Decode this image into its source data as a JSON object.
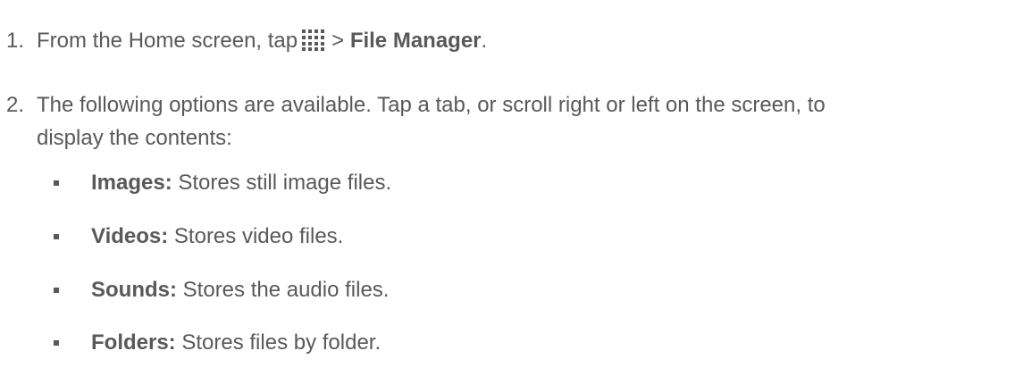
{
  "steps": [
    {
      "number": "1.",
      "before": "From the Home screen, tap",
      "icon": "apps-grid-icon",
      "separator": ">",
      "target": "File Manager",
      "after": "."
    },
    {
      "number": "2.",
      "line1": "The following options are available. Tap a tab, or scroll right or left on the screen, to",
      "line2": "display the contents:"
    }
  ],
  "options": [
    {
      "term": "Images:",
      "desc": " Stores still image files."
    },
    {
      "term": "Videos:",
      "desc": " Stores video files."
    },
    {
      "term": "Sounds:",
      "desc": " Stores the audio files."
    },
    {
      "term": "Folders:",
      "desc": " Stores files by folder."
    }
  ],
  "colors": {
    "text": "#595959",
    "icon": "#595959"
  }
}
